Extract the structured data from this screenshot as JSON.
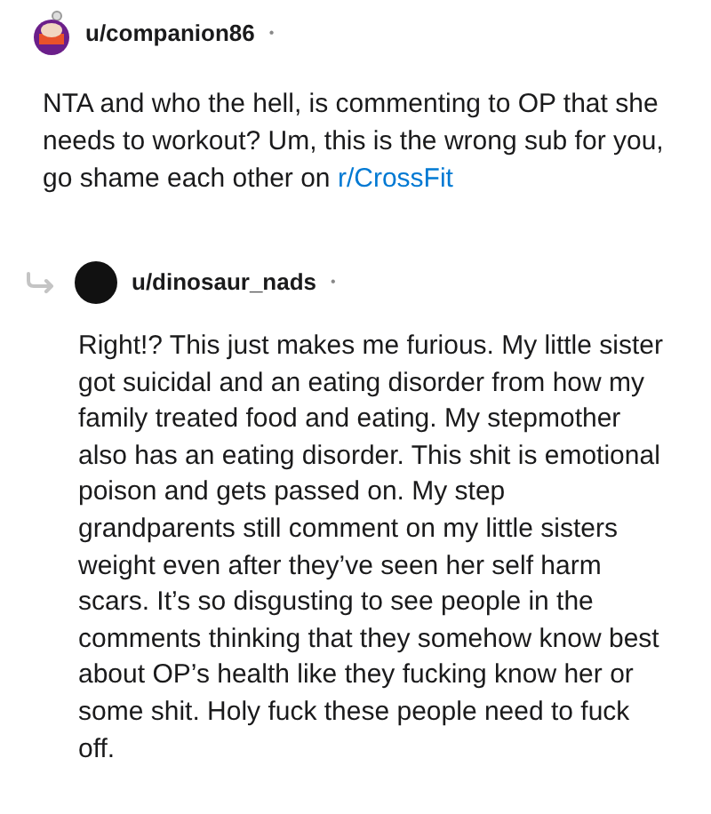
{
  "comments": [
    {
      "username": "u/companion86",
      "separator": "•",
      "is_reply": false,
      "body": "NTA and who the hell, is commenting to OP that she needs to workout? Um, this is the wrong sub for you, go shame each other on",
      "link": "r/CrossFit"
    },
    {
      "username": "u/dinosaur_nads",
      "separator": "•",
      "is_reply": true,
      "body": "Right!? This just makes me furious. My little sister got suicidal and an eating disorder from how my family treated food and eating. My stepmother also has an eating disorder. This shit is emotional poison and gets passed on. My step grandparents still comment on my little sisters weight even after they’ve seen her self harm scars. It’s so disgusting to see people in the comments thinking that they somehow know best about OP’s health like they fucking know her or some shit. Holy fuck these people need to fuck off."
    }
  ]
}
